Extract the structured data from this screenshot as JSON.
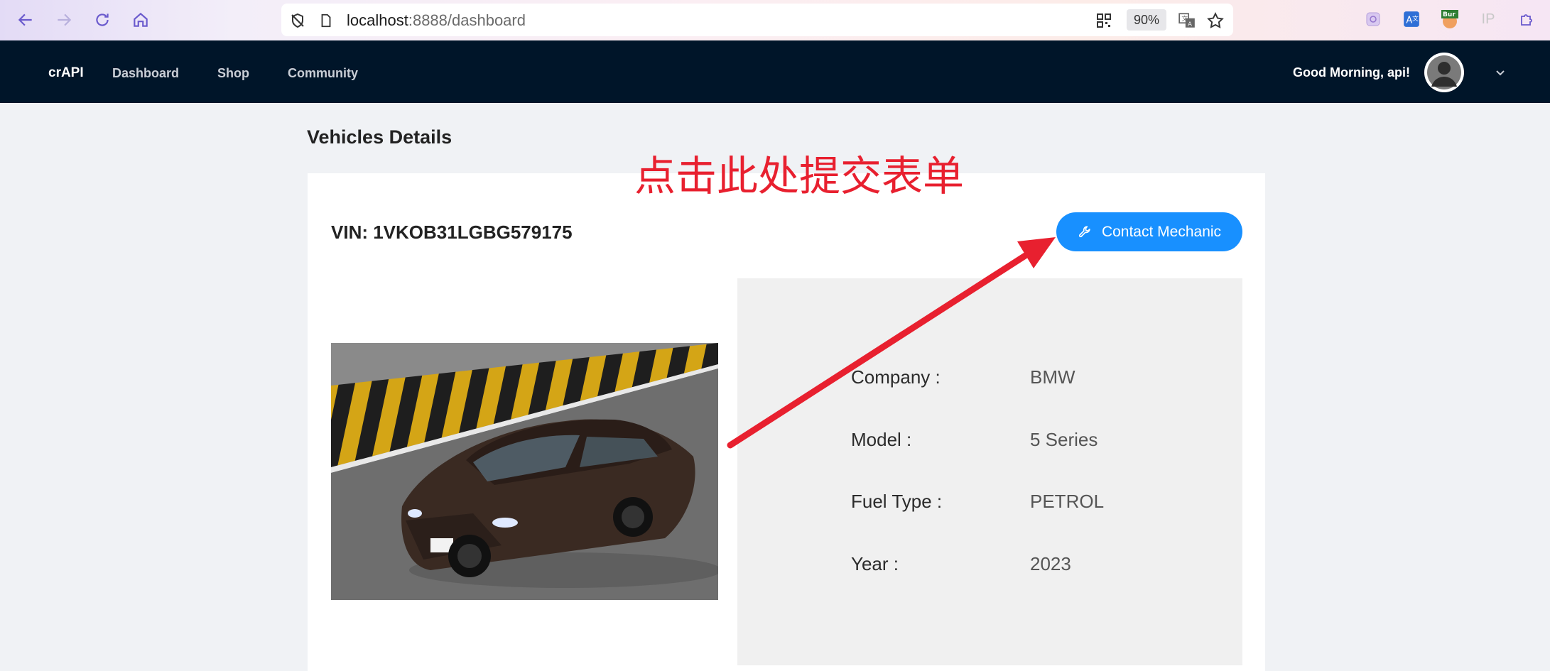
{
  "browser": {
    "url_host": "localhost",
    "url_path": ":8888/dashboard",
    "zoom": "90%",
    "extensions": [
      "extension-icon",
      "translate-icon",
      "burp-extension-icon",
      "ip-extension-icon",
      "extensions-puzzle-icon"
    ],
    "burp_label": "Bur",
    "ip_label": "IP"
  },
  "nav": {
    "brand": "crAPI",
    "links": [
      "Dashboard",
      "Shop",
      "Community"
    ],
    "greeting": "Good Morning, api!"
  },
  "page": {
    "section_title": "Vehicles Details",
    "annotation": "点击此处提交表单",
    "vin_label": "VIN: 1VKOB31LGBG579175",
    "contact_button": "Contact Mechanic",
    "details": [
      {
        "label": "Company :",
        "value": "BMW"
      },
      {
        "label": "Model :",
        "value": "5 Series"
      },
      {
        "label": "Fuel Type :",
        "value": "PETROL"
      },
      {
        "label": "Year :",
        "value": "2023"
      }
    ]
  },
  "colors": {
    "nav_bg": "#001529",
    "accent": "#1890ff",
    "annotation": "#e8202f"
  }
}
